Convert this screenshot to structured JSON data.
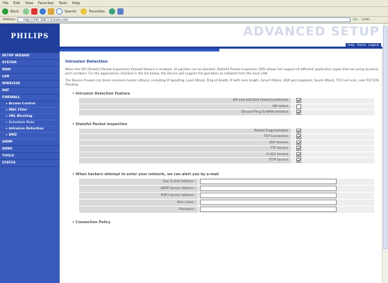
{
  "browser": {
    "menu": [
      "File",
      "Edit",
      "View",
      "Favorites",
      "Tools",
      "Help"
    ],
    "toolbar": {
      "back": "Back",
      "search": "Search",
      "favorites": "Favorites"
    },
    "address_label": "Address",
    "address_value": "http://192.168.1.1/index.stm",
    "go": "Go",
    "links": "Links"
  },
  "brand": {
    "logo": "PHILIPS",
    "title": "ADVANCED SETUP",
    "help": "Help",
    "home": "Home",
    "logout": "Logout"
  },
  "sidebar": {
    "items": [
      {
        "label": "SETUP WIZARD",
        "type": "item"
      },
      {
        "label": "SYSTEM",
        "type": "item"
      },
      {
        "label": "WAN",
        "type": "item"
      },
      {
        "label": "LAN",
        "type": "item"
      },
      {
        "label": "WIRELESS",
        "type": "item"
      },
      {
        "label": "NAT",
        "type": "item"
      },
      {
        "label": "FIREWALL",
        "type": "item"
      },
      {
        "label": "» Access Control",
        "type": "sub"
      },
      {
        "label": "» MAC Filter",
        "type": "sub"
      },
      {
        "label": "» URL Blocking",
        "type": "sub"
      },
      {
        "label": "» Schedule Rule",
        "type": "sub"
      },
      {
        "label": "» Intrusion Detection",
        "type": "sub"
      },
      {
        "label": "» DMZ",
        "type": "sub"
      },
      {
        "label": "SNMP",
        "type": "item"
      },
      {
        "label": "DDNS",
        "type": "item"
      },
      {
        "label": "TOOLS",
        "type": "item"
      },
      {
        "label": "STATUS",
        "type": "item"
      }
    ]
  },
  "content": {
    "title": "Intrusion Detection",
    "para1": "When the SPI (Stateful Packet Inspection) firewall feature is enabled, all packets can be blocked. Stateful Packet Inspection (SPI) allows full support of different application types that are using dynamic port numbers. For the applications checked in the list below, the Device will support full operation as initiated from the local LAN.",
    "para2": "The Device firewall can block common hacker attacks, including IP Spoofing, Land Attack, Ping of Death, IP with zero length, Smurf Attack, UDP port loopback, Snork Attack, TCP null scan, and TCP SYN flooding.",
    "group1": "• Intrusion Detection Feature",
    "features": [
      {
        "label": "SPI and Anti-DoS firewall protection",
        "checked": true
      },
      {
        "label": "RIP defect",
        "checked": false
      },
      {
        "label": "Discard Ping To WAN Interface",
        "checked": true
      }
    ],
    "group2": "• Stateful Packet Inspection",
    "spi": [
      {
        "label": "Packet Fragmentation",
        "checked": true
      },
      {
        "label": "TCP Connection",
        "checked": true
      },
      {
        "label": "UDP Session",
        "checked": true
      },
      {
        "label": "FTP Service",
        "checked": true
      },
      {
        "label": "H.323 Service",
        "checked": true
      },
      {
        "label": "TFTP Service",
        "checked": true
      }
    ],
    "group3": "• When hackers attempt to enter your network, we can alert you by e-mail",
    "email": [
      {
        "label": "Your E-mail Address :"
      },
      {
        "label": "SMTP Server Address :"
      },
      {
        "label": "POP3 Server Address :"
      },
      {
        "label": "User name :"
      },
      {
        "label": "Password :"
      }
    ],
    "group4": "• Connection Policy"
  }
}
